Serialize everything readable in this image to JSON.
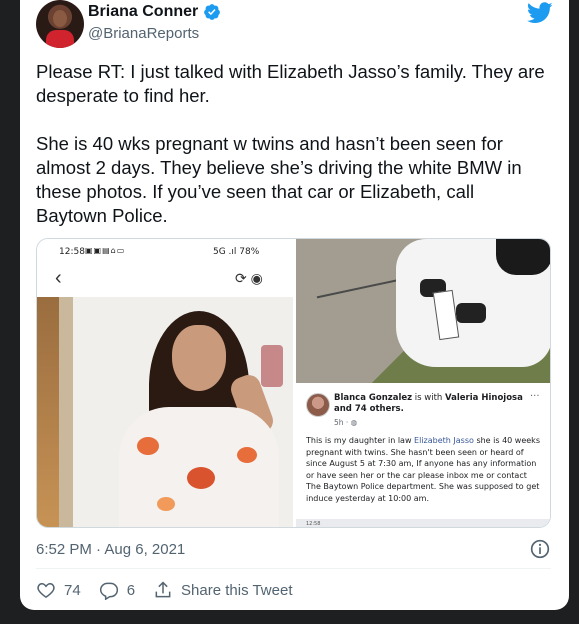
{
  "author": {
    "name": "Briana Conner",
    "handle": "@BrianaReports"
  },
  "icons": {
    "verified": "verified-badge-icon",
    "brand": "twitter-bird-icon",
    "info": "info-icon",
    "like": "heart-icon",
    "reply": "reply-icon",
    "share": "share-icon"
  },
  "colors": {
    "brand": "#1d9bf0",
    "text": "#0f1419",
    "muted": "#536471"
  },
  "tweet": {
    "paragraph1": "Please RT: I just talked with Elizabeth Jasso’s family. They are desperate to find her.",
    "paragraph2": "She is 40 wks pregnant w twins and hasn’t been seen for almost 2 days. They believe she’s driving the white BMW in these photos. If you’ve seen that car or Elizabeth, call Baytown Police."
  },
  "media": {
    "left": {
      "status_time": "12:58",
      "status_right": "5G .ıl 78%"
    },
    "right": {
      "fb_author": "Blanca Gonzalez",
      "fb_with_text": "is with",
      "fb_tagged": "Valeria Hinojosa",
      "fb_and_others": "and 74 others.",
      "fb_meta": "5h · ◍",
      "fb_text_before": "This is my daughter in law",
      "fb_link": "Elizabeth Jasso",
      "fb_text_after": "she is 40 weeks pregnant with twins. She hasn't been seen or heard of since August 5 at 7:30 am, If anyone has any information or have seen her or the car please inbox me or contact The Baytown Police department. She was supposed to get induce yesterday at 10:00 am.",
      "fb_bottom_status": "12:58"
    }
  },
  "footer": {
    "timestamp": "6:52 PM · Aug 6, 2021",
    "likes": "74",
    "replies": "6",
    "share_label": "Share this Tweet"
  }
}
